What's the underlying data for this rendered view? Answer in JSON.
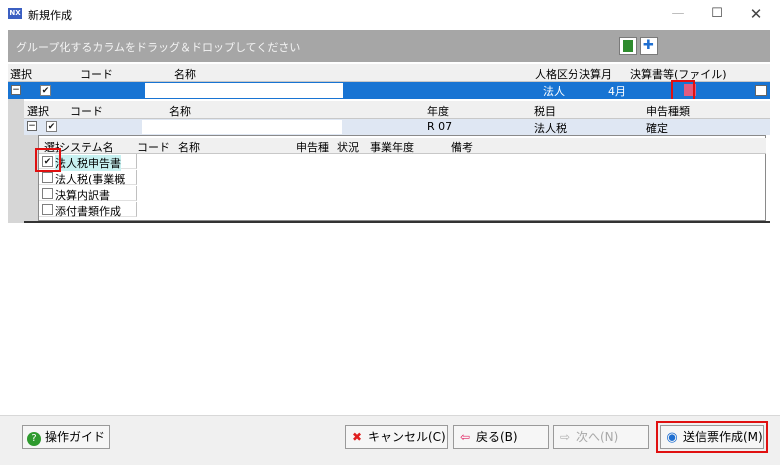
{
  "window": {
    "icon_text": "NX",
    "title": "新規作成",
    "minimize": "—",
    "maximize": "☐",
    "close": "✕"
  },
  "group_panel": {
    "hint": "グループ化するカラムをドラッグ＆ドロップしてください",
    "icons": [
      "excel-icon",
      "add-icon"
    ]
  },
  "outer_grid": {
    "headers": [
      "選択",
      "コード",
      "名称",
      "人格区分",
      "決算月",
      "決算書等(ファイル)"
    ],
    "row": {
      "expander": "−",
      "checked": true,
      "code": "",
      "name": "",
      "entity": "法人",
      "month": "4月"
    }
  },
  "detail_grid": {
    "headers": [
      "選択",
      "コード",
      "名称",
      "年度",
      "税目",
      "申告種類"
    ],
    "row": {
      "expander": "−",
      "checked": true,
      "code": "",
      "name": "",
      "year": "R 07",
      "tax": "法人税",
      "type": "確定"
    }
  },
  "system_grid": {
    "headers": [
      "選択",
      "システム名",
      "コード",
      "名称",
      "申告種",
      "状況",
      "事業年度",
      "備考"
    ],
    "rows": [
      {
        "name": "法人税申告書",
        "checked": true,
        "selected": true
      },
      {
        "name": "法人税(事業概",
        "checked": false,
        "selected": false
      },
      {
        "name": "決算内訳書",
        "checked": false,
        "selected": false
      },
      {
        "name": "添付書類作成",
        "checked": false,
        "selected": false
      }
    ]
  },
  "footer": {
    "guide": "操作ガイド",
    "cancel": "キャンセル(C)",
    "back": "戻る(B)",
    "next": "次へ(N)",
    "create": "送信票作成(M)"
  },
  "colors": {
    "selection": "#1874d3",
    "highlight": "#e01010"
  }
}
